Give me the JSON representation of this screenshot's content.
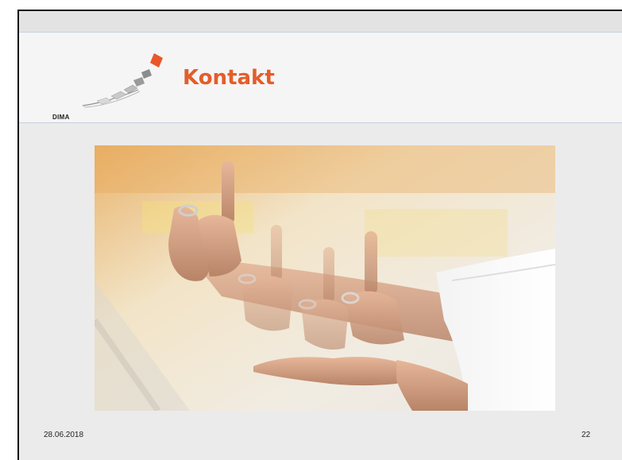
{
  "slide": {
    "title": "Kontakt",
    "logo_text": "DIMA",
    "footer_date": "28.06.2018",
    "page_number": "22"
  },
  "colors": {
    "title": "#e45d2a",
    "logo_accent": "#e8582a",
    "logo_gray": "#8c8c8c"
  },
  "image": {
    "description_icon": "hands-photo-icon"
  }
}
